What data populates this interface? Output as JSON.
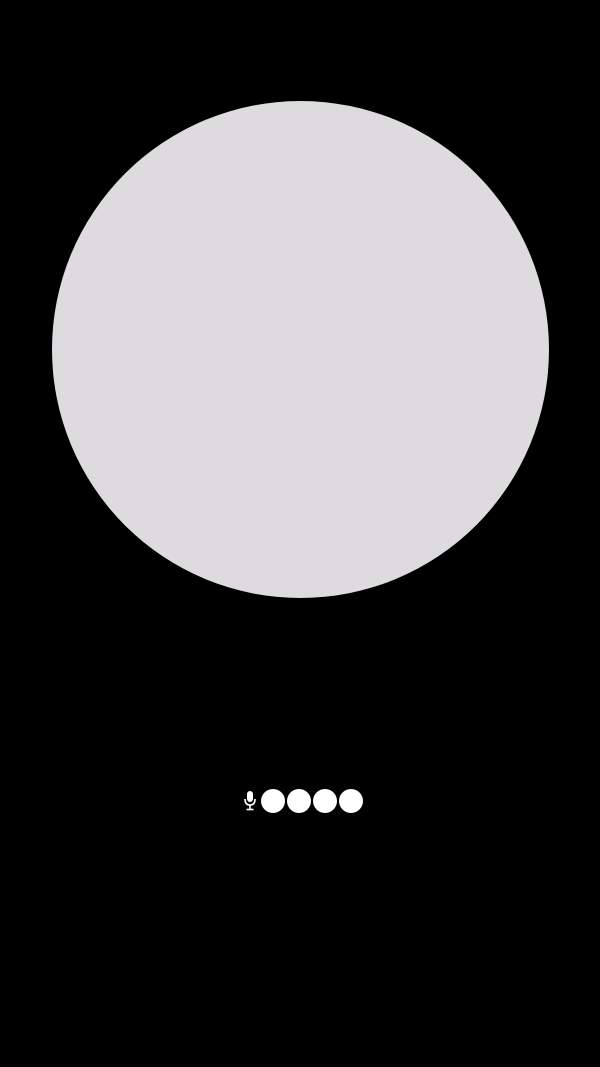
{
  "screen": {
    "background_color": "#000000"
  },
  "voice_orb": {
    "color": "#dddbde"
  },
  "listening_indicator": {
    "icon": "microphone-icon",
    "dot_count": 4,
    "dot_color": "#ffffff"
  }
}
